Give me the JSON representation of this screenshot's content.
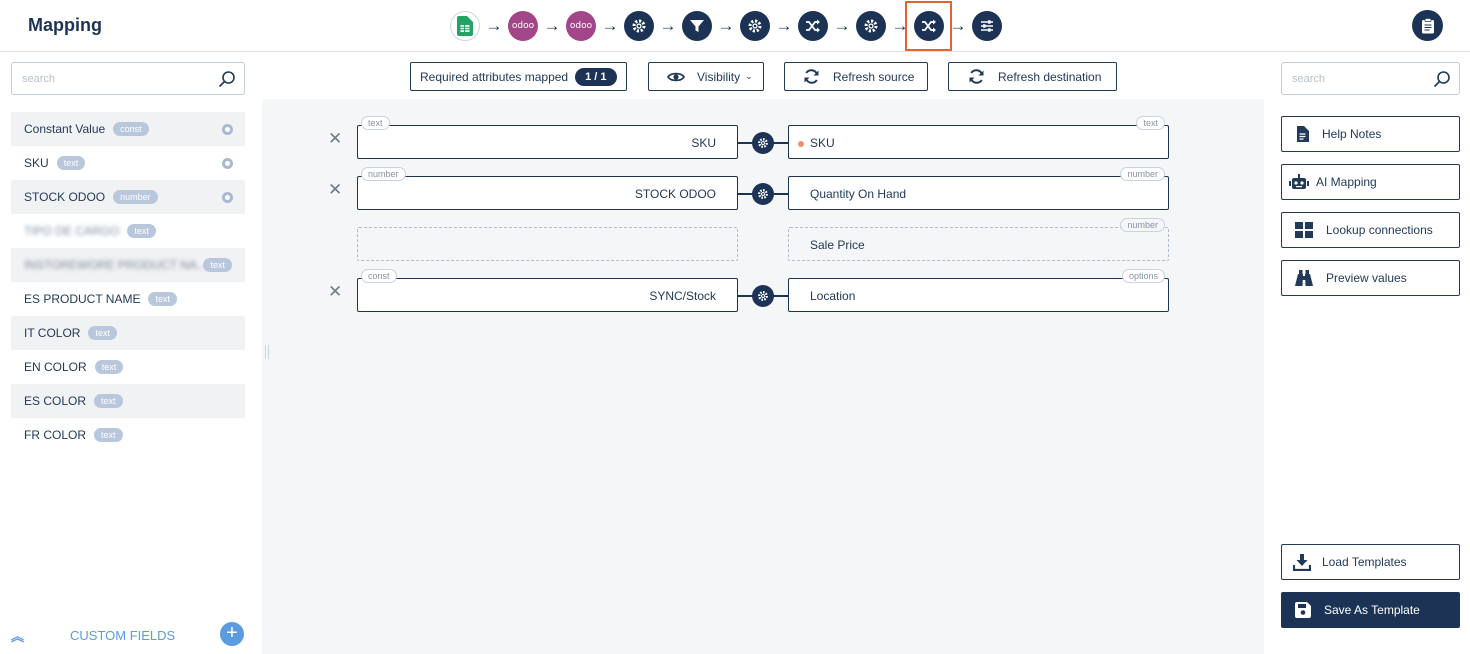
{
  "header": {
    "title": "Mapping",
    "steps": [
      {
        "icon": "sheets-icon"
      },
      {
        "icon": "odoo-icon",
        "label": "odoo"
      },
      {
        "icon": "odoo-icon",
        "label": "odoo"
      },
      {
        "icon": "gear-icon"
      },
      {
        "icon": "filter-icon"
      },
      {
        "icon": "gear-icon"
      },
      {
        "icon": "shuffle-icon"
      },
      {
        "icon": "gear-icon"
      },
      {
        "icon": "shuffle-icon",
        "active": true
      },
      {
        "icon": "sliders-icon"
      }
    ],
    "clipboard_icon": "clipboard-icon",
    "active_color": "#e8622c",
    "brand_color": "#1c3355",
    "odoo_color": "#a24689"
  },
  "left": {
    "search_placeholder": "search",
    "attributes": [
      {
        "label": "Constant Value",
        "type": "const",
        "dot": true
      },
      {
        "label": "SKU",
        "type": "text",
        "dot": true
      },
      {
        "label": "STOCK ODOO",
        "type": "number",
        "dot": true
      },
      {
        "label": "TIPO DE CARGO",
        "type": "text",
        "blurred": true
      },
      {
        "label": "INSTOREWORE PRODUCT NA...",
        "type": "text",
        "blurred": true
      },
      {
        "label": "ES PRODUCT NAME",
        "type": "text"
      },
      {
        "label": "IT COLOR",
        "type": "text"
      },
      {
        "label": "EN COLOR",
        "type": "text"
      },
      {
        "label": "ES COLOR",
        "type": "text"
      },
      {
        "label": "FR COLOR",
        "type": "text"
      }
    ],
    "custom_fields_label": "CUSTOM FIELDS",
    "add_symbol": "+"
  },
  "toolbar": {
    "required_label": "Required attributes mapped",
    "required_count": "1 / 1",
    "visibility_label": "Visibility",
    "refresh_source_label": "Refresh source",
    "refresh_destination_label": "Refresh destination"
  },
  "mappings": [
    {
      "source": "SKU",
      "source_type": "text",
      "dest": "SKU",
      "dest_type": "text",
      "required": true,
      "mapped": true
    },
    {
      "source": "STOCK ODOO",
      "source_type": "number",
      "dest": "Quantity On Hand",
      "dest_type": "number",
      "mapped": true
    },
    {
      "source": "",
      "source_type": "",
      "dest": "Sale Price",
      "dest_type": "number",
      "mapped": false
    },
    {
      "source": "SYNC/Stock",
      "source_type": "const",
      "dest": "Location",
      "dest_type": "options",
      "mapped": true
    }
  ],
  "right": {
    "search_placeholder": "search",
    "help_notes": "Help Notes",
    "ai_mapping": "AI Mapping",
    "lookup": "Lookup connections",
    "preview": "Preview values",
    "load_templates": "Load Templates",
    "save_template": "Save As Template"
  }
}
